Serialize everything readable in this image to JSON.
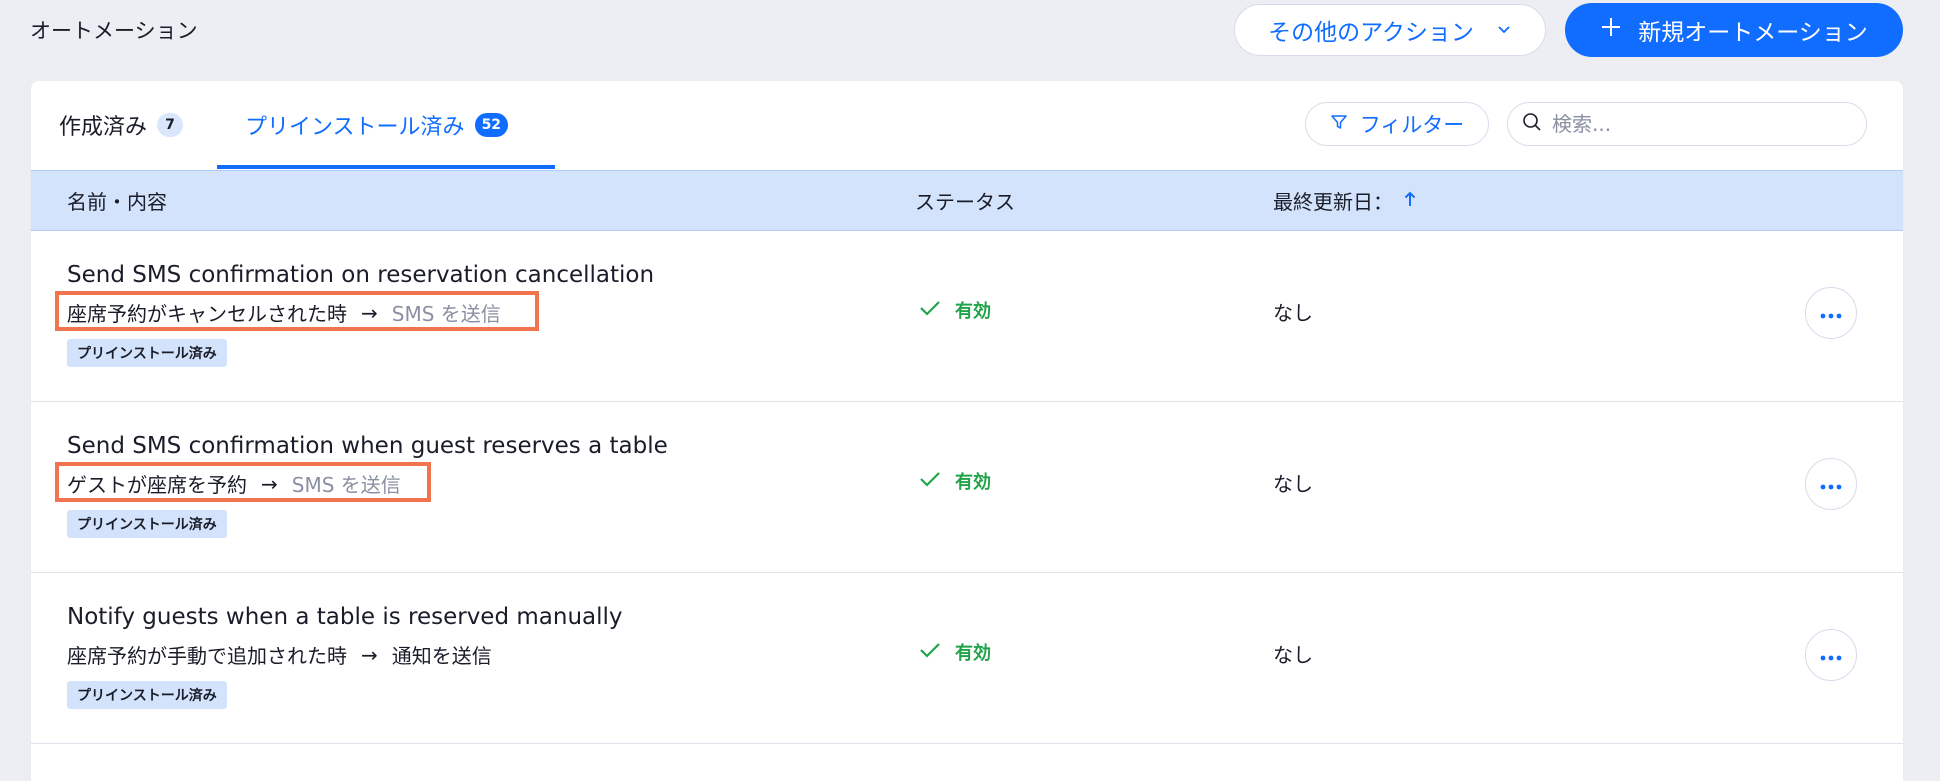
{
  "header": {
    "title": "オートメーション",
    "more_actions_label": "その他のアクション",
    "new_automation_label": "新規オートメーション"
  },
  "tabs": [
    {
      "label": "作成済み",
      "count": "7",
      "active": false
    },
    {
      "label": "プリインストール済み",
      "count": "52",
      "active": true
    }
  ],
  "toolbar": {
    "filter_label": "フィルター",
    "search_placeholder": "検索..."
  },
  "table": {
    "columns": {
      "name": "名前・内容",
      "status": "ステータス",
      "updated": "最終更新日：",
      "sort_direction": "ascending"
    },
    "rows": [
      {
        "title": "Send SMS confirmation on reservation cancellation",
        "trigger": "座席予約がキャンセルされた時",
        "arrow": "→",
        "action": "SMS を送信",
        "badge": "プリインストール済み",
        "status": "有効",
        "updated": "なし",
        "highlighted": true
      },
      {
        "title": "Send SMS confirmation when guest reserves a table",
        "trigger": "ゲストが座席を予約",
        "arrow": "→",
        "action": "SMS を送信",
        "badge": "プリインストール済み",
        "status": "有効",
        "updated": "なし",
        "highlighted": true
      },
      {
        "title": "Notify guests when a table is reserved manually",
        "trigger": "座席予約が手動で追加された時",
        "arrow": "→",
        "action": "通知を送信",
        "badge": "プリインストール済み",
        "status": "有効",
        "updated": "なし",
        "highlighted": false
      }
    ]
  },
  "colors": {
    "accent": "#116dff",
    "status_active": "#21a34a",
    "highlight": "#f2744f",
    "header_bg": "#d4e3fc"
  },
  "icons": {
    "more_actions": "chevron-down-icon",
    "new_automation": "plus-icon",
    "filter": "filter-icon",
    "search": "search-icon",
    "sort": "arrow-up-icon",
    "status": "check-icon",
    "row_menu": "more-horizontal-icon"
  }
}
